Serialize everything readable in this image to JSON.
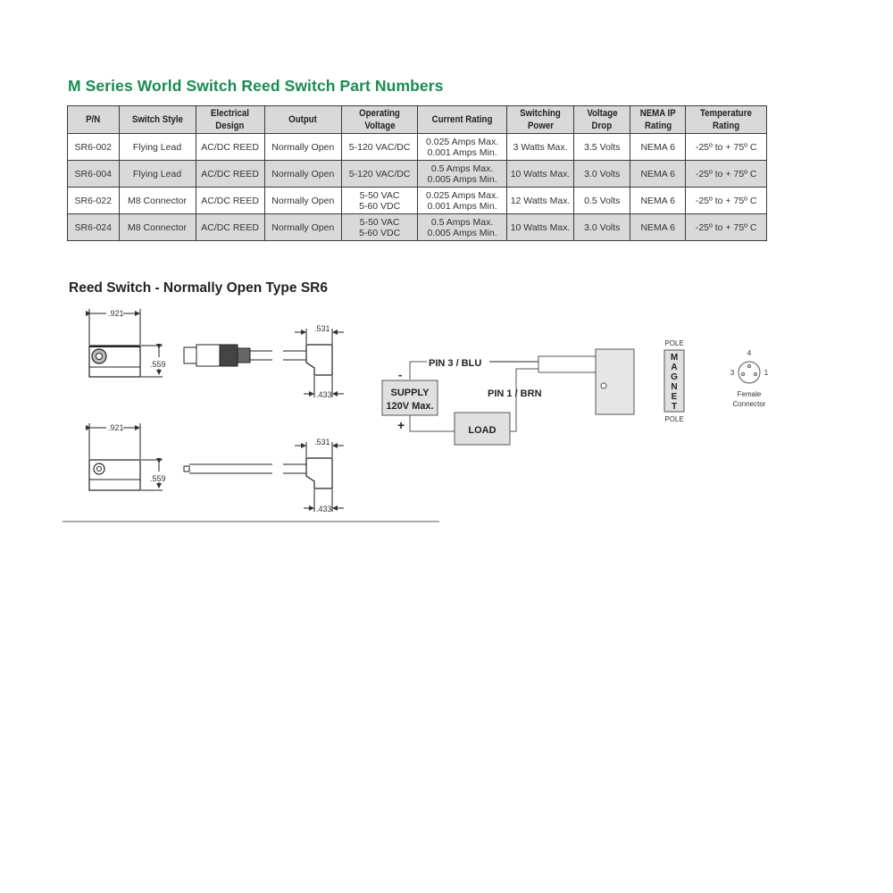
{
  "title": "M Series World Switch Reed Switch Part Numbers",
  "table": {
    "headers": [
      {
        "l1": "P/N",
        "l2": ""
      },
      {
        "l1": "Switch Style",
        "l2": ""
      },
      {
        "l1": "Electrical",
        "l2": "Design"
      },
      {
        "l1": "Output",
        "l2": ""
      },
      {
        "l1": "Operating",
        "l2": "Voltage"
      },
      {
        "l1": "Current Rating",
        "l2": ""
      },
      {
        "l1": "Switching",
        "l2": "Power"
      },
      {
        "l1": "Voltage",
        "l2": "Drop"
      },
      {
        "l1": "NEMA IP",
        "l2": "Rating"
      },
      {
        "l1": "Temperature",
        "l2": "Rating"
      }
    ],
    "rows": [
      {
        "pn": "SR6-002",
        "style": "Flying Lead",
        "design": "AC/DC REED",
        "output": "Normally Open",
        "volt1": "5-120 VAC/DC",
        "volt2": "",
        "cur1": "0.025 Amps Max.",
        "cur2": "0.001 Amps Min.",
        "power": "3 Watts Max.",
        "drop": "3.5 Volts",
        "nema": "NEMA 6",
        "temp": "-25º to + 75º C"
      },
      {
        "pn": "SR6-004",
        "style": "Flying Lead",
        "design": "AC/DC REED",
        "output": "Normally Open",
        "volt1": "5-120 VAC/DC",
        "volt2": "",
        "cur1": "0.5 Amps Max.",
        "cur2": "0.005 Amps Min.",
        "power": "10 Watts Max.",
        "drop": "3.0 Volts",
        "nema": "NEMA 6",
        "temp": "-25º to + 75º C"
      },
      {
        "pn": "SR6-022",
        "style": "M8 Connector",
        "design": "AC/DC REED",
        "output": "Normally Open",
        "volt1": "5-50 VAC",
        "volt2": "5-60 VDC",
        "cur1": "0.025 Amps Max.",
        "cur2": "0.001 Amps Min.",
        "power": "12 Watts Max.",
        "drop": "0.5 Volts",
        "nema": "NEMA 6",
        "temp": "-25º to + 75º C"
      },
      {
        "pn": "SR6-024",
        "style": "M8 Connector",
        "design": "AC/DC REED",
        "output": "Normally Open",
        "volt1": "5-50 VAC",
        "volt2": "5-60 VDC",
        "cur1": "0.5 Amps Max.",
        "cur2": "0.005 Amps Min.",
        "power": "10 Watts Max.",
        "drop": "3.0 Volts",
        "nema": "NEMA 6",
        "temp": "-25º to + 75º C"
      }
    ]
  },
  "diagram": {
    "subtitle": "Reed Switch - Normally Open Type SR6",
    "dims": {
      "width": ".921",
      "height": ".559",
      "cable_width": ".531",
      "cable_base": ".433"
    },
    "wiring": {
      "pin3": "PIN 3 / BLU",
      "pin1": "PIN 1 / BRN",
      "supply_l1": "SUPPLY",
      "supply_l2": "120V Max.",
      "minus": "-",
      "plus": "+",
      "load": "LOAD",
      "pole_top": "POLE",
      "pole_bottom": "POLE",
      "magnet_letters": [
        "M",
        "A",
        "G",
        "N",
        "E",
        "T"
      ]
    },
    "connector": {
      "pin_top": "4",
      "pin_left": "3",
      "pin_right": "1",
      "label_l1": "Female",
      "label_l2": "Connector"
    }
  }
}
